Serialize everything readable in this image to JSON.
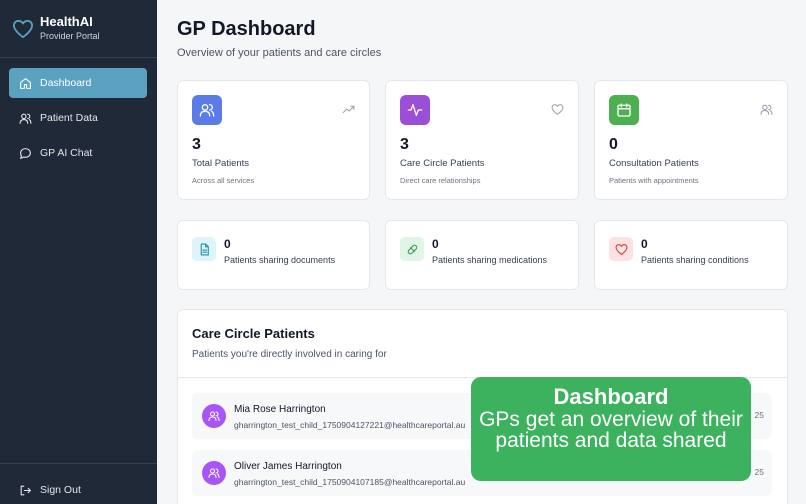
{
  "brand": {
    "name": "HealthAI",
    "subtitle": "Provider Portal"
  },
  "nav": [
    {
      "label": "Dashboard",
      "icon": "home-icon",
      "active": true
    },
    {
      "label": "Patient Data",
      "icon": "users-icon",
      "active": false
    },
    {
      "label": "GP AI Chat",
      "icon": "chat-bubble-icon",
      "active": false
    }
  ],
  "signout": {
    "label": "Sign Out",
    "icon": "sign-out-icon"
  },
  "header": {
    "title": "GP Dashboard",
    "subtitle": "Overview of your patients and care circles"
  },
  "stats": [
    {
      "value": "3",
      "label": "Total Patients",
      "desc": "Across all services",
      "icon": "users-icon",
      "icon_color": "#5b7be8",
      "corner_icon": "trending-up-icon"
    },
    {
      "value": "3",
      "label": "Care Circle Patients",
      "desc": "Direct care relationships",
      "icon": "activity-icon",
      "icon_color": "#9b4fd6",
      "corner_icon": "heart-icon"
    },
    {
      "value": "0",
      "label": "Consultation Patients",
      "desc": "Patients with appointments",
      "icon": "calendar-icon",
      "icon_color": "#4caf50",
      "corner_icon": "users-icon"
    }
  ],
  "sharing": [
    {
      "value": "0",
      "label": "Patients sharing documents",
      "icon": "document-icon",
      "bg": "#dff4f8",
      "color": "#1f8fa8"
    },
    {
      "value": "0",
      "label": "Patients sharing medications",
      "icon": "pill-icon",
      "bg": "#dff5e5",
      "color": "#2f9e52"
    },
    {
      "value": "0",
      "label": "Patients sharing conditions",
      "icon": "heart-icon",
      "bg": "#fbe3e3",
      "color": "#d94a4a"
    }
  ],
  "care_circle": {
    "title": "Care Circle Patients",
    "subtitle": "Patients you're directly involved in caring for",
    "patients": [
      {
        "name": "Mia Rose Harrington",
        "email": "gharrington_test_child_1750904127221@healthcareportal.au",
        "date_fragment": "25"
      },
      {
        "name": "Oliver James Harrington",
        "email": "gharrington_test_child_1750904107185@healthcareportal.au",
        "date_fragment": "25"
      }
    ]
  },
  "overlay": {
    "title": "Dashboard",
    "body": "GPs get an overview of their patients and data shared"
  },
  "colors": {
    "sidebar": "#1f2937",
    "active_nav": "#5ba1c0",
    "overlay": "#3cb15e",
    "avatar": "#a855f7"
  }
}
